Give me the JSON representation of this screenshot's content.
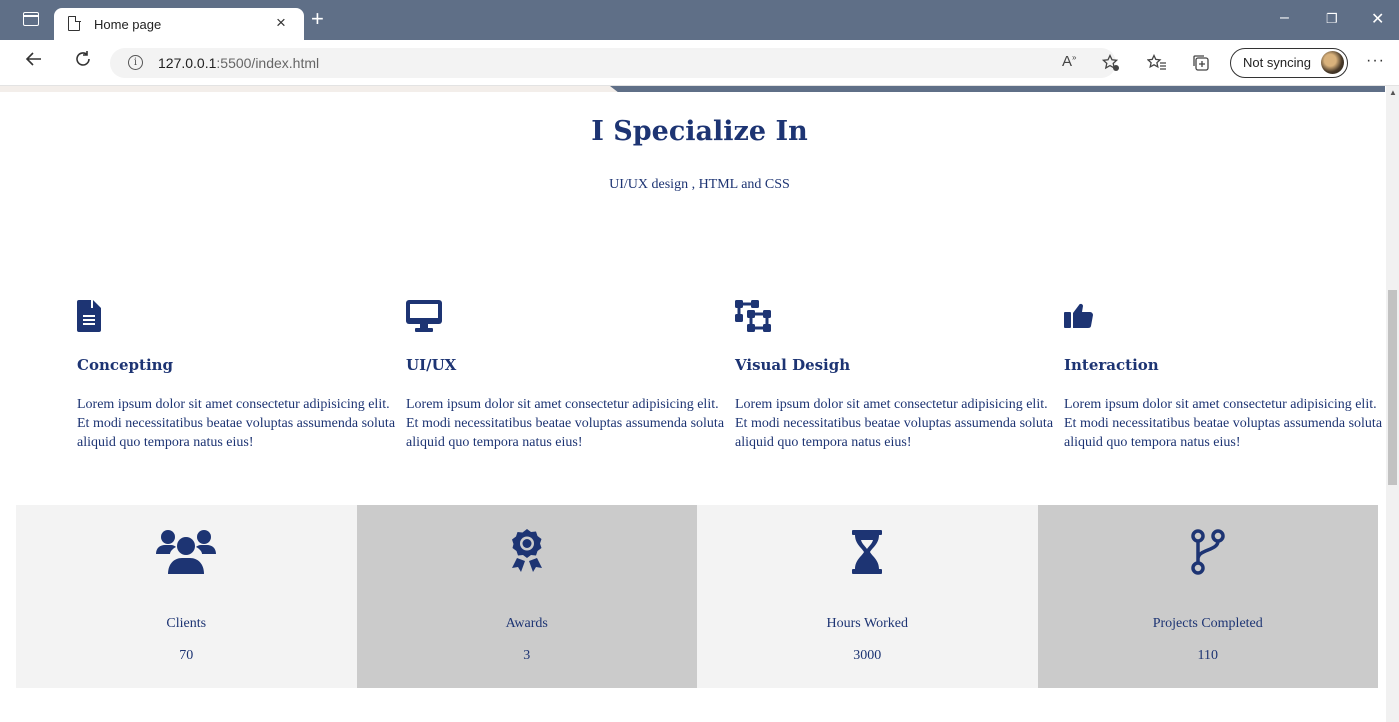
{
  "browser": {
    "tab_title": "Home page",
    "tab_close": "×",
    "new_tab": "+",
    "window_controls": {
      "minimize": "–",
      "restore": "❐",
      "close": "✕"
    },
    "url_host": "127.0.0.1",
    "url_path": ":5500/index.html",
    "sync_label": "Not syncing",
    "more": "···"
  },
  "colors": {
    "accent": "#1d3473",
    "chrome": "#5f6f87",
    "stat_light": "#f3f3f3",
    "stat_dark": "#cbcbcb"
  },
  "section": {
    "heading": "I Specialize In",
    "subheading": "UI/UX design , HTML and CSS"
  },
  "services": [
    {
      "icon": "file-icon",
      "title": "Concepting",
      "text": "Lorem ipsum dolor sit amet consectetur adipisicing elit. Et modi necessitatibus beatae voluptas assumenda soluta aliquid quo tempora natus eius!"
    },
    {
      "icon": "desktop-icon",
      "title": "UI/UX",
      "text": "Lorem ipsum dolor sit amet consectetur adipisicing elit. Et modi necessitatibus beatae voluptas assumenda soluta aliquid quo tempora natus eius!"
    },
    {
      "icon": "object-ungroup-icon",
      "title": "Visual Desigh",
      "text": "Lorem ipsum dolor sit amet consectetur adipisicing elit. Et modi necessitatibus beatae voluptas assumenda soluta aliquid quo tempora natus eius!"
    },
    {
      "icon": "thumbs-up-icon",
      "title": "Interaction",
      "text": "Lorem ipsum dolor sit amet consectetur adipisicing elit. Et modi necessitatibus beatae voluptas assumenda soluta aliquid quo tempora natus eius!"
    }
  ],
  "stats": [
    {
      "icon": "users-icon",
      "label": "Clients",
      "value": "70"
    },
    {
      "icon": "award-icon",
      "label": "Awards",
      "value": "3"
    },
    {
      "icon": "hourglass-icon",
      "label": "Hours Worked",
      "value": "3000"
    },
    {
      "icon": "code-branch-icon",
      "label": "Projects Completed",
      "value": "110"
    }
  ]
}
